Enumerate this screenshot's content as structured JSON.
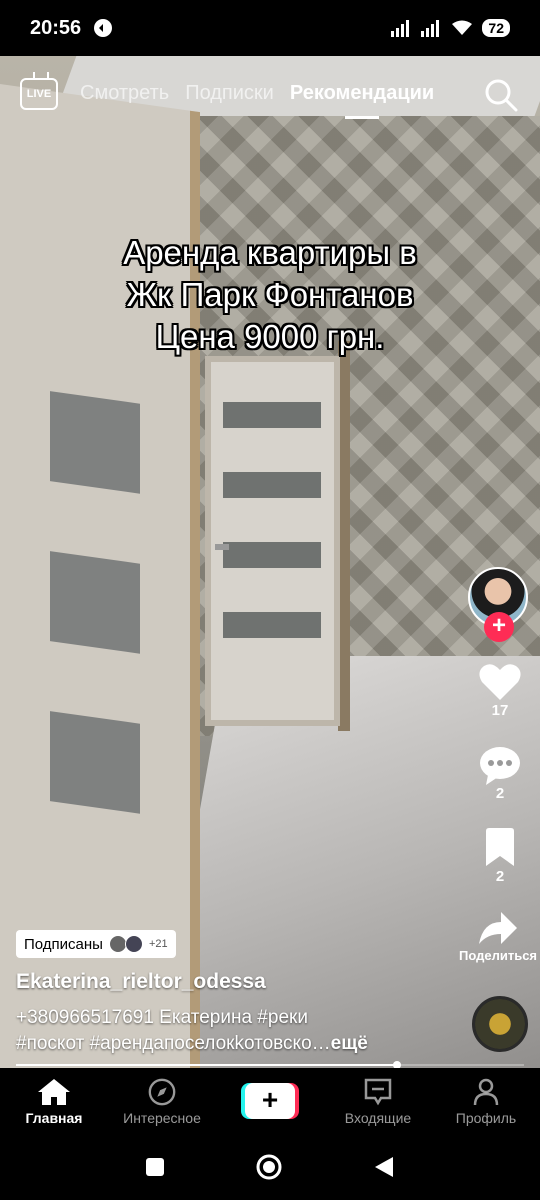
{
  "status_bar": {
    "time": "20:56",
    "battery": "72"
  },
  "top_nav": {
    "live_label": "LIVE",
    "tabs": [
      {
        "label": "Смотреть"
      },
      {
        "label": "Подписки"
      },
      {
        "label": "Рекомендации",
        "active": true
      }
    ]
  },
  "video": {
    "overlay_lines": [
      "Аренда квартиры в",
      "Жк Парк Фонтанов",
      "Цена 9000 грн."
    ]
  },
  "actions": {
    "likes": "17",
    "comments": "2",
    "saves": "2",
    "share_label": "Поделиться"
  },
  "post": {
    "subscribed_label": "Подписаны",
    "subscribed_extra": "+21",
    "author": "Ekaterina_rieltor_odessa",
    "description_line1": "+380966517691 Екатерина #реки",
    "description_line2": "#поскот #арендапоселокkотовско…",
    "more_label": "ещё",
    "progress": 0.75
  },
  "bottom_nav": {
    "items": [
      {
        "label": "Главная",
        "icon": "home-icon",
        "active": true
      },
      {
        "label": "Интересное",
        "icon": "compass-icon"
      },
      {
        "label": "",
        "icon": "create-icon"
      },
      {
        "label": "Входящие",
        "icon": "inbox-icon"
      },
      {
        "label": "Профиль",
        "icon": "profile-icon"
      }
    ]
  },
  "colors": {
    "accent_red": "#fe2c55",
    "accent_cyan": "#25f4ee"
  }
}
